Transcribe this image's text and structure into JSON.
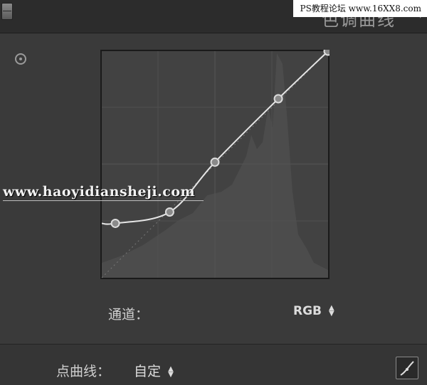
{
  "panel": {
    "title": "色调曲线",
    "watermark_site": "PS教程论坛 www.16XX8.com",
    "watermark_text": "www.haoyidiansheji.com"
  },
  "channel": {
    "label": "通道：",
    "value": "RGB"
  },
  "point_curve": {
    "label": "点曲线：",
    "value": "自定"
  },
  "curve": {
    "points": [
      [
        0.06,
        0.24
      ],
      [
        0.3,
        0.29
      ],
      [
        0.5,
        0.51
      ],
      [
        0.78,
        0.79
      ],
      [
        1.0,
        1.0
      ]
    ],
    "left_endpoint": [
      0.0,
      0.24
    ],
    "colors": {
      "background": "#3e3e3e",
      "curve": "#e6e6e6",
      "grid": "#555555",
      "histogram": "#4b4b4b"
    }
  }
}
